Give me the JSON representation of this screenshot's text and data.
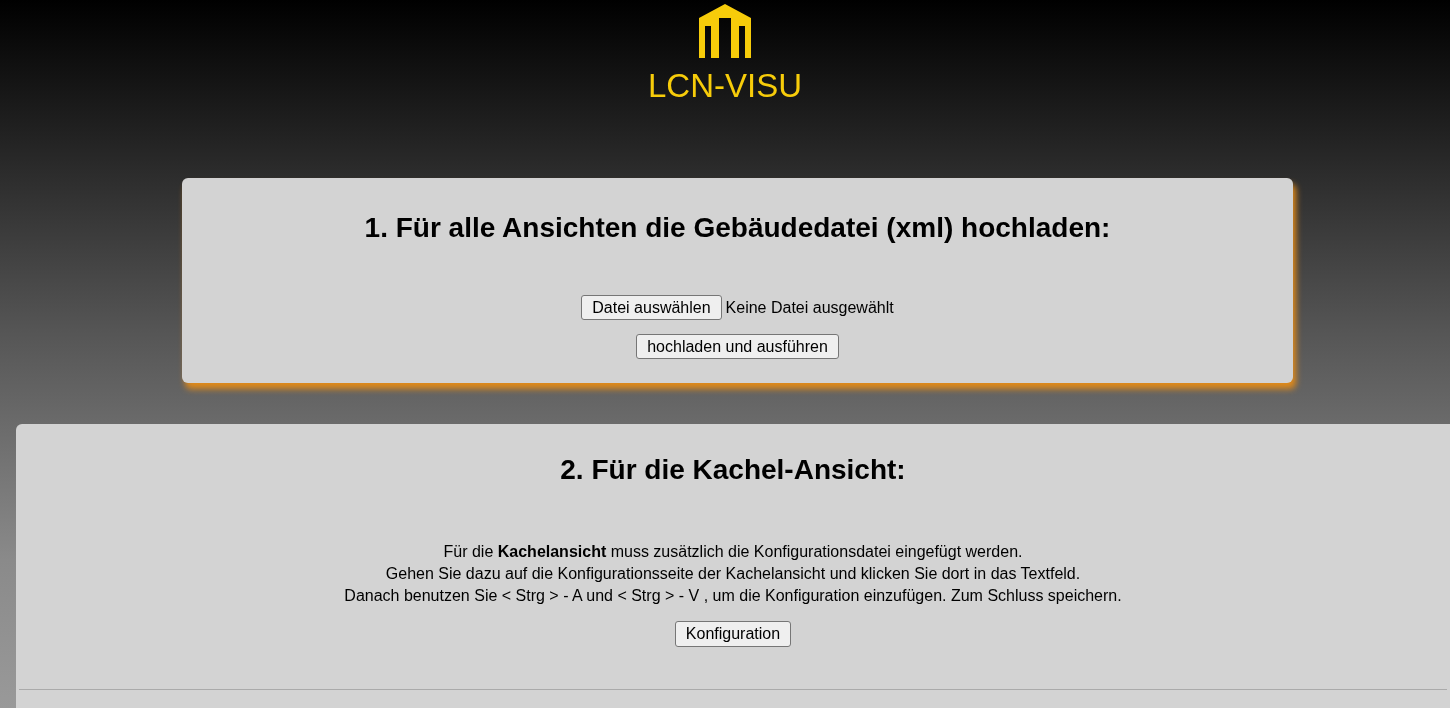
{
  "logo": {
    "text": "LCN-VISU"
  },
  "upload_section": {
    "heading": "1. Für alle Ansichten die Gebäudedatei (xml) hochladen:",
    "file_button": "Datei auswählen",
    "file_status": "Keine Datei ausgewählt",
    "submit_button": "hochladen und ausführen"
  },
  "tile_section": {
    "heading": "2. Für die Kachel-Ansicht:",
    "instructions": [
      "Für die **Kachelansicht** muss zusätzlich die Konfigurationsdatei eingefügt werden.",
      "Gehen Sie dazu auf die Konfigurationsseite der Kachelansicht und klicken Sie dort in das Textfeld.",
      "Danach benutzen Sie < Strg > - A und < Strg > - V , um die Konfiguration einzufügen. Zum Schluss speichern."
    ],
    "button": "Konfiguration"
  }
}
